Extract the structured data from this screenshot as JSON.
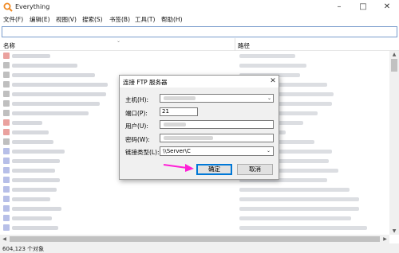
{
  "window": {
    "title": "Everything"
  },
  "colors": {
    "accent": "#0078d7",
    "app_icon": "#f08a24",
    "annotation_arrow": "#ff1fd6"
  },
  "menu": {
    "items": [
      {
        "label": "文件(F)"
      },
      {
        "label": "编辑(E)"
      },
      {
        "label": "视图(V)"
      },
      {
        "label": "搜索(S)"
      },
      {
        "label": "书签(B)"
      },
      {
        "label": "工具(T)"
      },
      {
        "label": "帮助(H)"
      }
    ]
  },
  "search": {
    "value": ""
  },
  "columns": {
    "name": "名称",
    "path": "路径"
  },
  "status": {
    "text": "604,123 个对象"
  },
  "dialog": {
    "title": "连接 FTP 服务器",
    "host_label": "主机(H):",
    "port_label": "端口(P):",
    "port_value": "21",
    "user_label": "用户(U):",
    "password_label": "密码(W):",
    "link_type_label": "链接类型(L):",
    "link_type_value": "\\\\Server\\C",
    "ok_label": "确定",
    "cancel_label": "取消"
  }
}
